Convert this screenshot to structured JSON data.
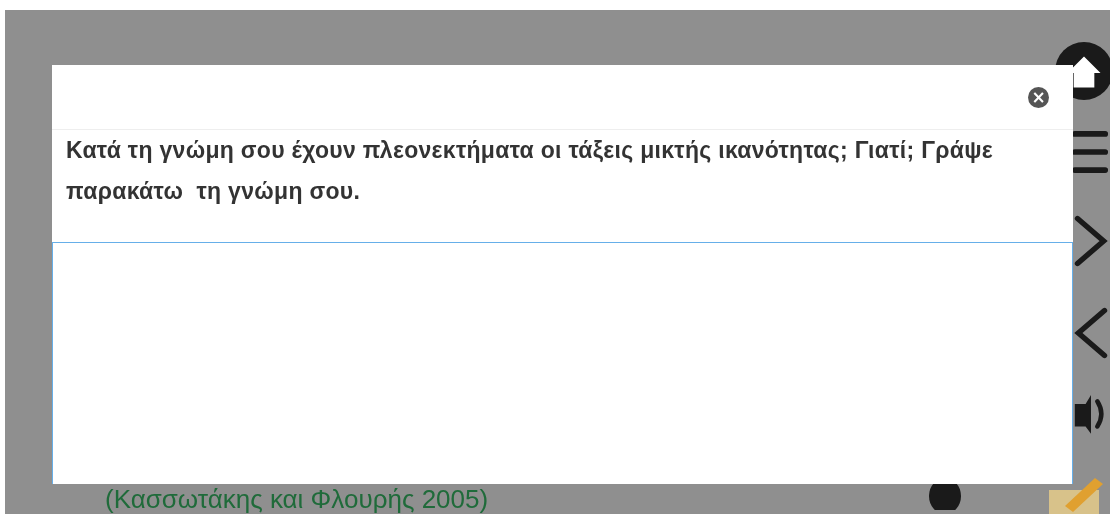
{
  "page": {
    "citation": "(Κασσωτάκης και Φλουρής 2005)"
  },
  "modal": {
    "close": "×",
    "question": "Κατά τη γνώμη σου έχουν πλεονεκτήματα οι τάξεις μικτής ικανότητας; Γιατί; Γράψε παρακάτω  τη γνώμη σου."
  }
}
